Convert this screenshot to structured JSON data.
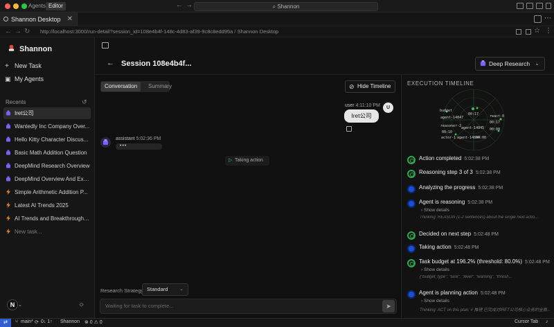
{
  "titlebar": {
    "tab_agents": "Agents",
    "tab_editor": "Editor",
    "search": "Shannon"
  },
  "browser": {
    "tab_title": "Shannon Desktop",
    "url": "http://localhost:3000/run-detail?session_id=108e4b4f-148c-4d83-af39-9c8c8edd95a / Shannon Desktop"
  },
  "sidebar": {
    "brand": "Shannon",
    "new_task": "New Task",
    "my_agents": "My Agents",
    "recents_label": "Recents",
    "recents": [
      {
        "label": "Iret公司",
        "icon": "agent-icon",
        "color": "#7b61ff"
      },
      {
        "label": "Wantedly Inc Company Over...",
        "icon": "agent-icon",
        "color": "#7b61ff"
      },
      {
        "label": "Hello Kitty Character Discus...",
        "icon": "agent-icon",
        "color": "#7b61ff"
      },
      {
        "label": "Basic Math Addition Question",
        "icon": "agent-icon",
        "color": "#7b61ff"
      },
      {
        "label": "DeepMind Research Overview",
        "icon": "agent-icon",
        "color": "#7b61ff"
      },
      {
        "label": "DeepMind Overview And Exp...",
        "icon": "agent-icon",
        "color": "#7b61ff"
      },
      {
        "label": "Simple Arithmetic Addition P...",
        "icon": "bolt-icon",
        "color": "#e9892b"
      },
      {
        "label": "Latest AI Trends 2025",
        "icon": "bolt-icon",
        "color": "#e9892b"
      },
      {
        "label": "AI Trends and Breakthroughs...",
        "icon": "bolt-icon",
        "color": "#e9892b"
      },
      {
        "label": "New task...",
        "icon": "bolt-icon",
        "color": "#e9892b"
      }
    ],
    "avatar_letter": "N"
  },
  "header": {
    "session_title": "Session 108e4b4f...",
    "mode": "Deep Research"
  },
  "conversation": {
    "tabs": [
      "Conversation",
      "Summary"
    ],
    "hide_timeline": "Hide Timeline",
    "user_role": "user",
    "user_time": "4:11:10 PM",
    "user_message": "Iret公司",
    "user_avatar": "U",
    "assistant_role": "assistant",
    "assistant_time": "5:02:36 PM",
    "typing": "•••",
    "taking_action": "Taking action",
    "strategy_label": "Research Strategy:",
    "strategy_value": "Standard",
    "composer_placeholder": "Waiting for task to complete..."
  },
  "timeline": {
    "title": "EXECUTION TIMELINE",
    "graph_labels": [
      "budget",
      "agent-14847",
      "00:17",
      "reasoner-2",
      "agent-14845",
      "00:10",
      "actor-1",
      "agent-14844",
      "00:00",
      "react-0",
      "00:17",
      "00:08"
    ],
    "items": [
      {
        "label": "Action completed",
        "time": "5:02:38 PM",
        "status": "done"
      },
      {
        "label": "Reasoning step 3 of 3",
        "time": "5:02:38 PM",
        "status": "done"
      },
      {
        "label": "Analyzing the progress",
        "time": "5:02:38 PM",
        "status": "progress"
      },
      {
        "label": "Agent is reasoning",
        "time": "5:02:38 PM",
        "status": "progress",
        "details": "Show details",
        "sub": "Thinking: REASON (1-2 sentences) about the single next actio..."
      },
      {
        "label": "Decided on next step",
        "time": "5:02:48 PM",
        "status": "done"
      },
      {
        "label": "Taking action",
        "time": "5:02:48 PM",
        "status": "progress"
      },
      {
        "label": "Task budget at 196.2% (threshold: 80.0%)",
        "time": "5:02:48 PM",
        "status": "done",
        "details": "Show details",
        "sub": "{\"budget_type\": \"task\", \"level\": \"warning\", \"thresh..."
      },
      {
        "label": "Agent is planning action",
        "time": "5:02:48 PM",
        "status": "progress",
        "details": "Show details",
        "sub": "Thinking: ACT on this plan: # 推理 已完成对IRET公司核心业务的全面..."
      }
    ]
  },
  "statusbar": {
    "branch": "main*",
    "sync": "0↓ 1↑",
    "project": "Shannon",
    "problems": "⊗ 0  ⚠ 0",
    "right": "Cursor Tab"
  },
  "colors": {
    "accent_green": "#2fa54e",
    "accent_blue": "#1d4fd6",
    "agent_purple": "#7b61ff",
    "bolt_orange": "#e9892b"
  }
}
